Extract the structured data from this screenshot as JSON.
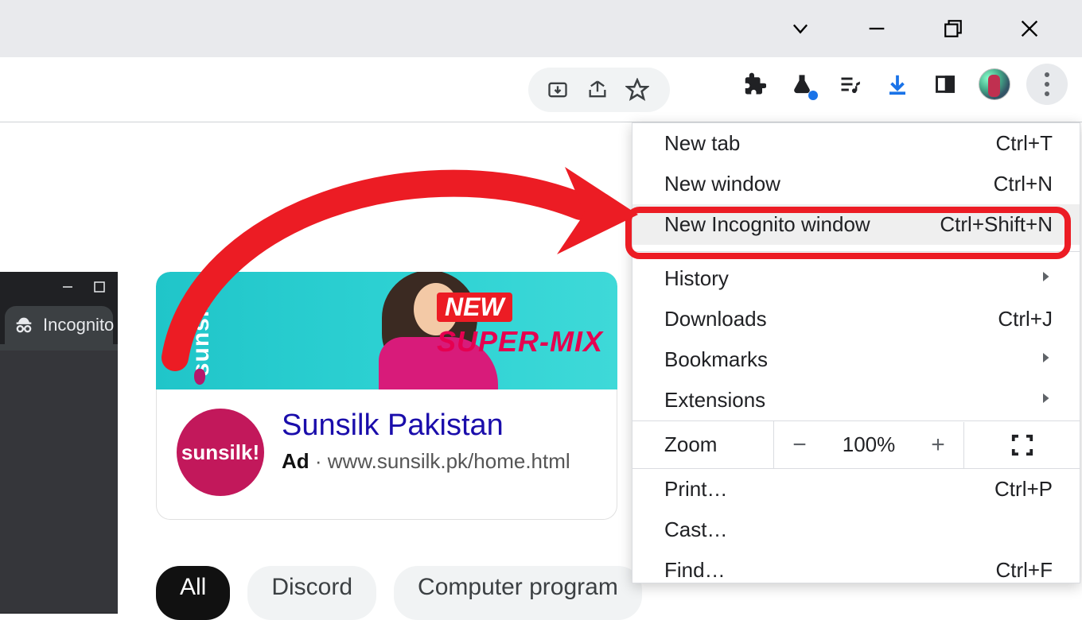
{
  "toolbar": {
    "icons": {
      "install": "install-icon",
      "share": "share-icon",
      "star": "star-icon",
      "extension": "extension-icon",
      "labs": "labs-icon",
      "media": "media-icon",
      "downloads": "downloads-icon",
      "sidepanel": "sidepanel-icon"
    }
  },
  "menu": {
    "new_tab": {
      "label": "New tab",
      "shortcut": "Ctrl+T"
    },
    "new_window": {
      "label": "New window",
      "shortcut": "Ctrl+N"
    },
    "new_incognito": {
      "label": "New Incognito window",
      "shortcut": "Ctrl+Shift+N"
    },
    "history": {
      "label": "History"
    },
    "downloads": {
      "label": "Downloads",
      "shortcut": "Ctrl+J"
    },
    "bookmarks": {
      "label": "Bookmarks"
    },
    "extensions": {
      "label": "Extensions"
    },
    "zoom": {
      "label": "Zoom",
      "pct": "100%",
      "minus": "−",
      "plus": "+"
    },
    "print": {
      "label": "Print…",
      "shortcut": "Ctrl+P"
    },
    "cast": {
      "label": "Cast…"
    },
    "find": {
      "label": "Find…",
      "shortcut": "Ctrl+F"
    }
  },
  "incognito": {
    "tab_label": "Incognito"
  },
  "ad": {
    "brand_vertical": "sunsilk",
    "banner_line1": "NEW",
    "banner_line2": "SUPER-MIX",
    "brand_circle": "sunsilk!",
    "title": "Sunsilk Pakistan",
    "subline_bold": "Ad",
    "subline_sep": " · ",
    "subline_url": "www.sunsilk.pk/home.html"
  },
  "chips": [
    "All",
    "Discord",
    "Computer program"
  ]
}
